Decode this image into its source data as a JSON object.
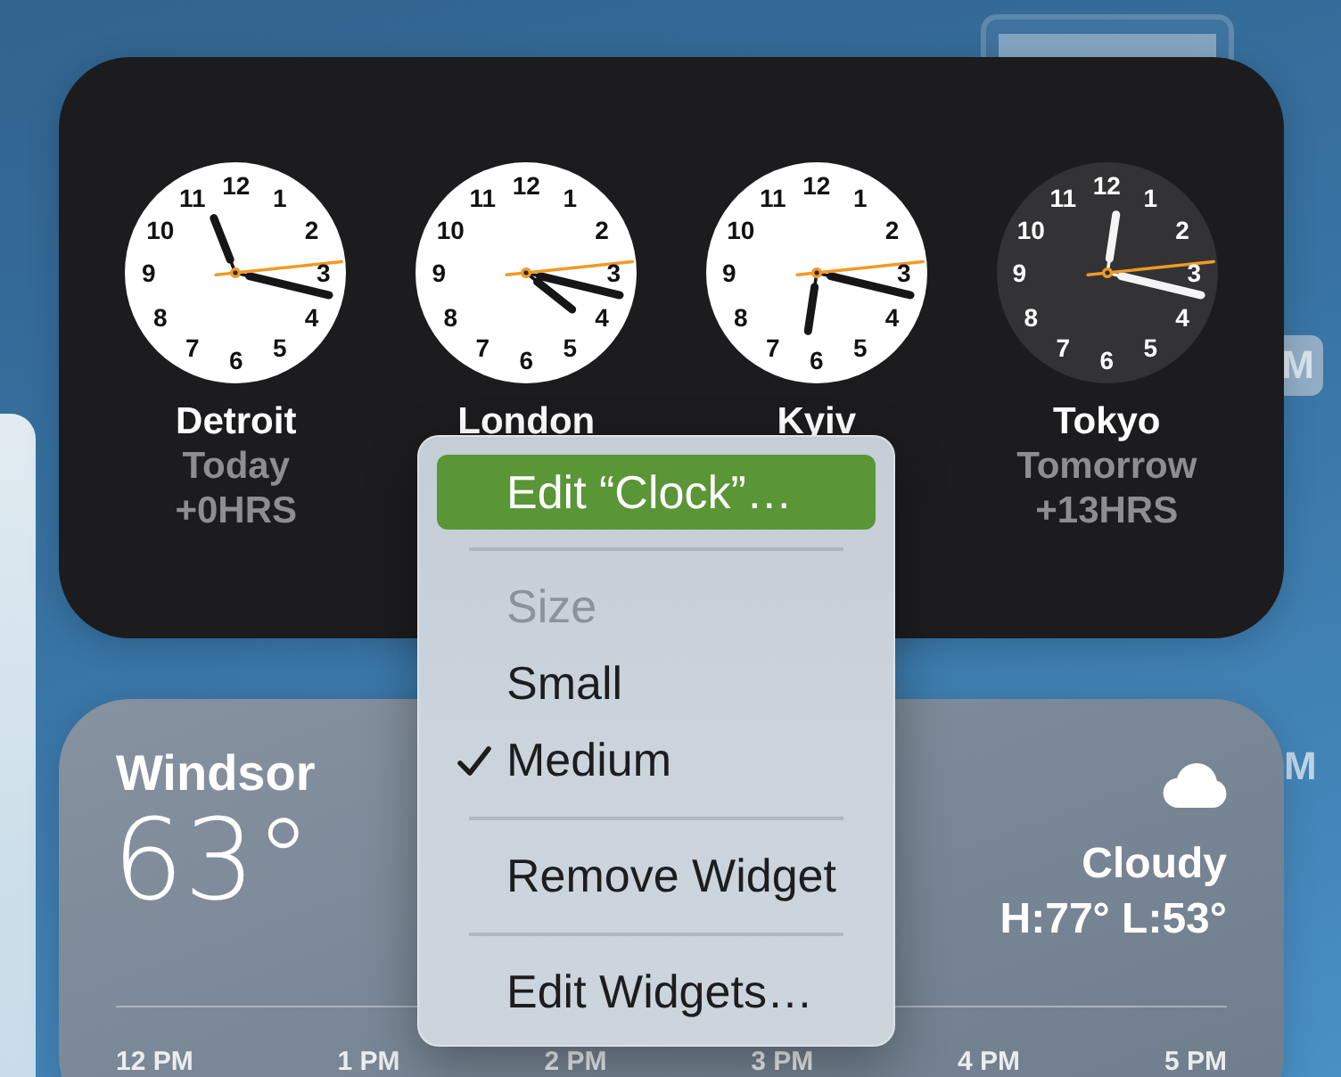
{
  "desktop": {
    "upper_tag": "M",
    "lower_text": "M"
  },
  "clock_widget": {
    "clocks": [
      {
        "city": "Detroit",
        "day": "Today",
        "offset": "+0HRS",
        "night": false,
        "numerals": [
          "12",
          "11",
          "1",
          "10",
          "2",
          "9",
          "3",
          "8",
          "4",
          "7",
          "5",
          "6"
        ]
      },
      {
        "city": "London",
        "night": false,
        "numerals": [
          "12",
          "11",
          "1",
          "10",
          "2",
          "9",
          "3",
          "8",
          "4",
          "7",
          "5",
          "6"
        ]
      },
      {
        "city": "Kyiv",
        "night": false,
        "numerals": [
          "12",
          "11",
          "1",
          "10",
          "2",
          "9",
          "3",
          "8",
          "4",
          "7",
          "5",
          "6"
        ]
      },
      {
        "city": "Tokyo",
        "day": "Tomorrow",
        "offset": "+13HRS",
        "night": true,
        "numerals": [
          "12",
          "11",
          "1",
          "10",
          "2",
          "9",
          "3",
          "8",
          "4",
          "7",
          "5",
          "6"
        ]
      }
    ]
  },
  "context_menu": {
    "items": [
      {
        "kind": "action",
        "label": "Edit “Clock”…",
        "highlighted": true
      },
      {
        "kind": "separator"
      },
      {
        "kind": "header",
        "label": "Size"
      },
      {
        "kind": "option",
        "label": "Small",
        "checked": false
      },
      {
        "kind": "option",
        "label": "Medium",
        "checked": true
      },
      {
        "kind": "separator"
      },
      {
        "kind": "action",
        "label": "Remove Widget",
        "highlighted": false
      },
      {
        "kind": "separator"
      },
      {
        "kind": "action",
        "label": "Edit Widgets…",
        "highlighted": false
      }
    ]
  },
  "weather_widget": {
    "location": "Windsor",
    "temperature": "63°",
    "condition": "Cloudy",
    "high_low": "H:77° L:53°",
    "hours": [
      "12 PM",
      "1 PM",
      "2 PM",
      "3 PM",
      "4 PM",
      "5 PM"
    ]
  }
}
